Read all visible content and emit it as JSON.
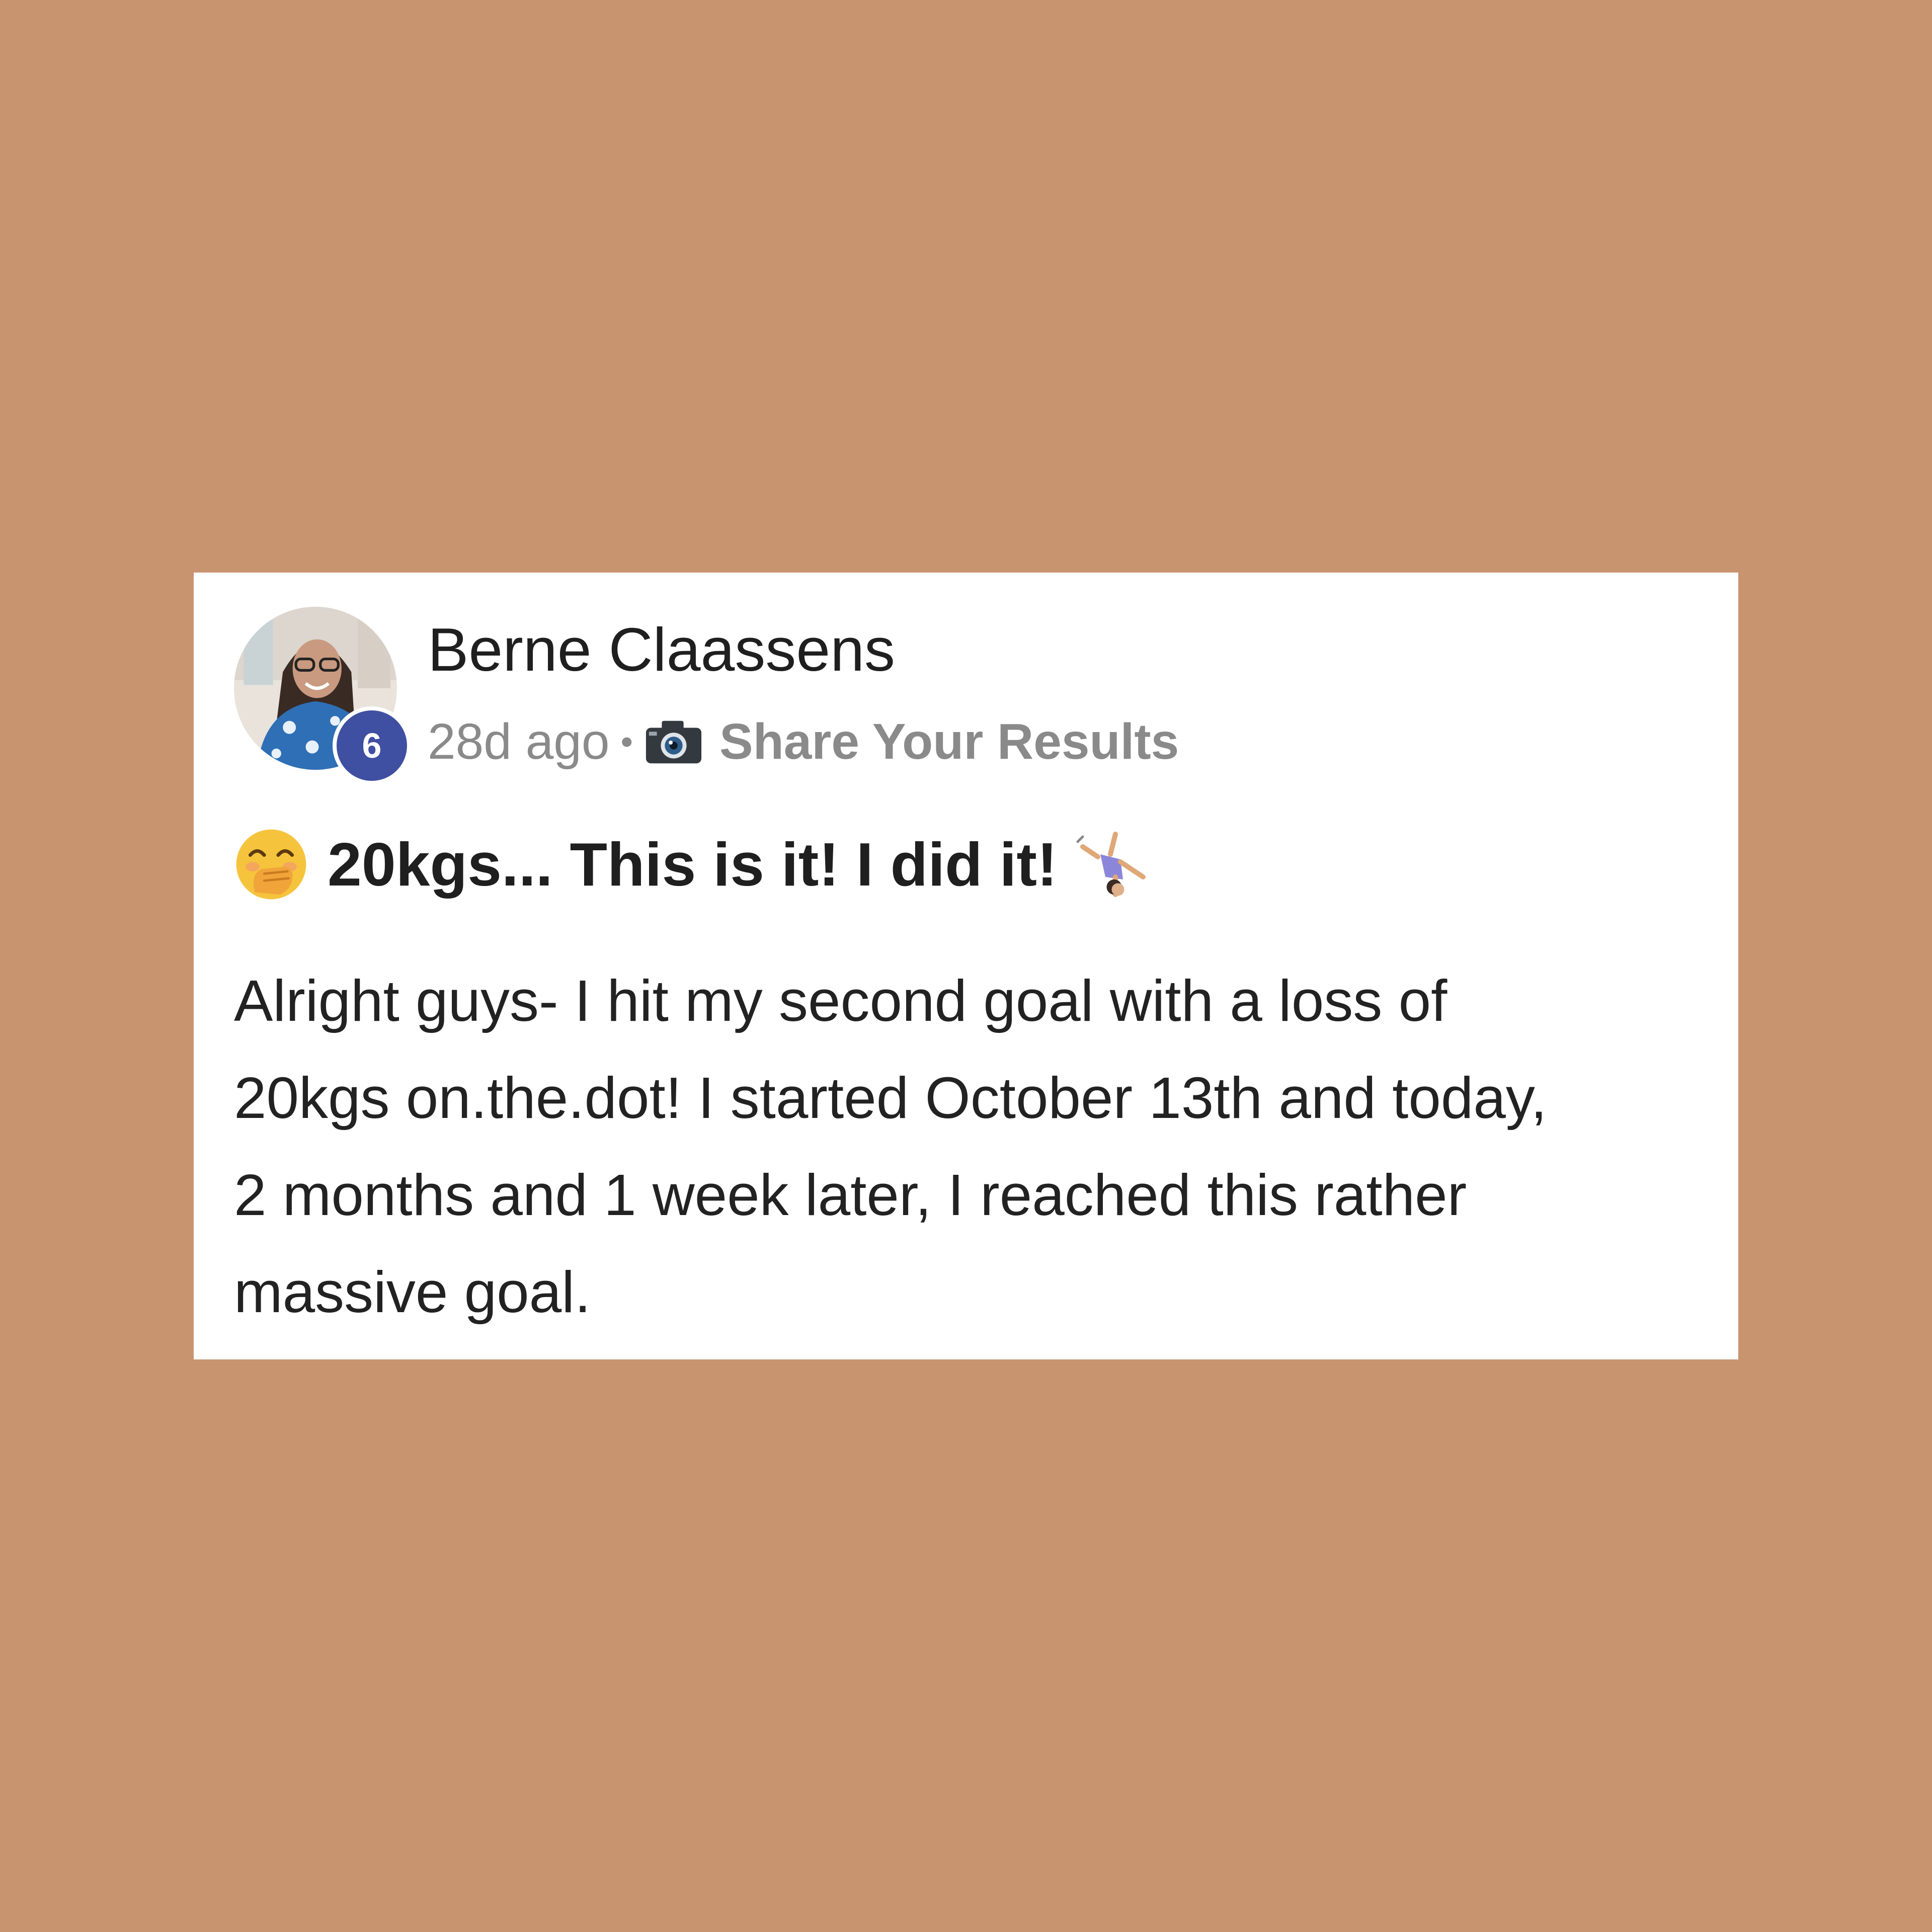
{
  "post": {
    "author": "Berne Claassens",
    "level_badge": "6",
    "time": "28d ago",
    "separator": "•",
    "category_icon": "camera-icon",
    "category": "Share Your Results",
    "title_leading_emoji": "face-with-hand-over-mouth-emoji",
    "title": "20kgs... This is it! I did it!",
    "title_trailing_emoji": "person-cartwheeling-emoji",
    "body_lines": [
      "Alright guys- I hit my second goal with a loss of",
      "20kgs on.the.dot! I started October 13th and today,",
      "2 months and 1 week later, I reached this rather",
      "massive goal."
    ]
  },
  "colors": {
    "background": "#c89470",
    "card": "#ffffff",
    "badge": "#3f4fa2",
    "muted_text": "#8a8a8a",
    "primary_text": "#1f1f1f"
  }
}
